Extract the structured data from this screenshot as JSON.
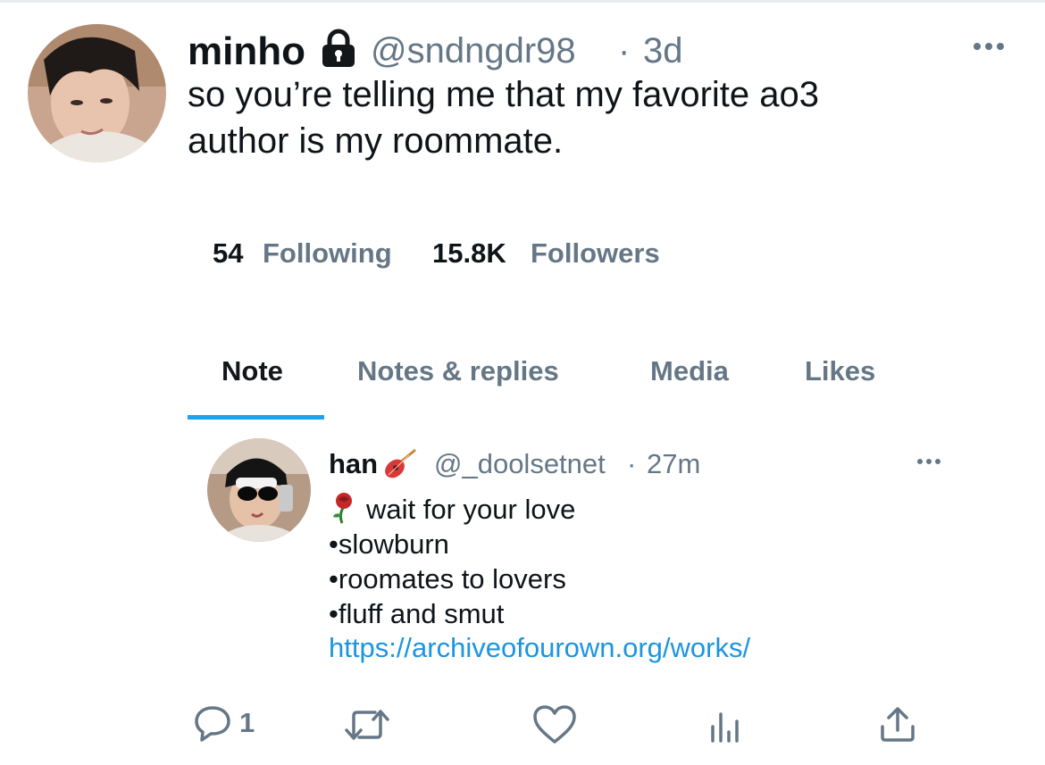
{
  "tweet": {
    "display_name": "minho",
    "handle": "@sndngdr98",
    "separator": "·",
    "time": "3d",
    "text_line1": "so you’re telling me that my favorite ao3",
    "text_line2": "author is my roommate."
  },
  "profile": {
    "following_count": "54",
    "following_label": "Following",
    "followers_count": "15.8K",
    "followers_label": "Followers"
  },
  "tabs": [
    {
      "label": "Note",
      "active": true
    },
    {
      "label": "Notes & replies",
      "active": false
    },
    {
      "label": "Media",
      "active": false
    },
    {
      "label": "Likes",
      "active": false
    }
  ],
  "embedded": {
    "display_name": "han",
    "handle": "@_doolsetnet",
    "separator": "·",
    "time": "27m",
    "title": "wait for your love",
    "bullet1": "•slowburn",
    "bullet2": "•roomates to lovers",
    "bullet3": "•fluff and smut",
    "link": "https://archiveofourown.org/works/"
  },
  "actions": {
    "reply_count": "1"
  },
  "icons": [
    "lock-icon",
    "more-icon",
    "guitar-icon",
    "rose-icon",
    "reply-icon",
    "retweet-icon",
    "like-icon",
    "analytics-icon",
    "share-icon"
  ],
  "colors": {
    "accent": "#1da1f2",
    "link": "#1b95e0",
    "secondary_text": "#657786"
  }
}
